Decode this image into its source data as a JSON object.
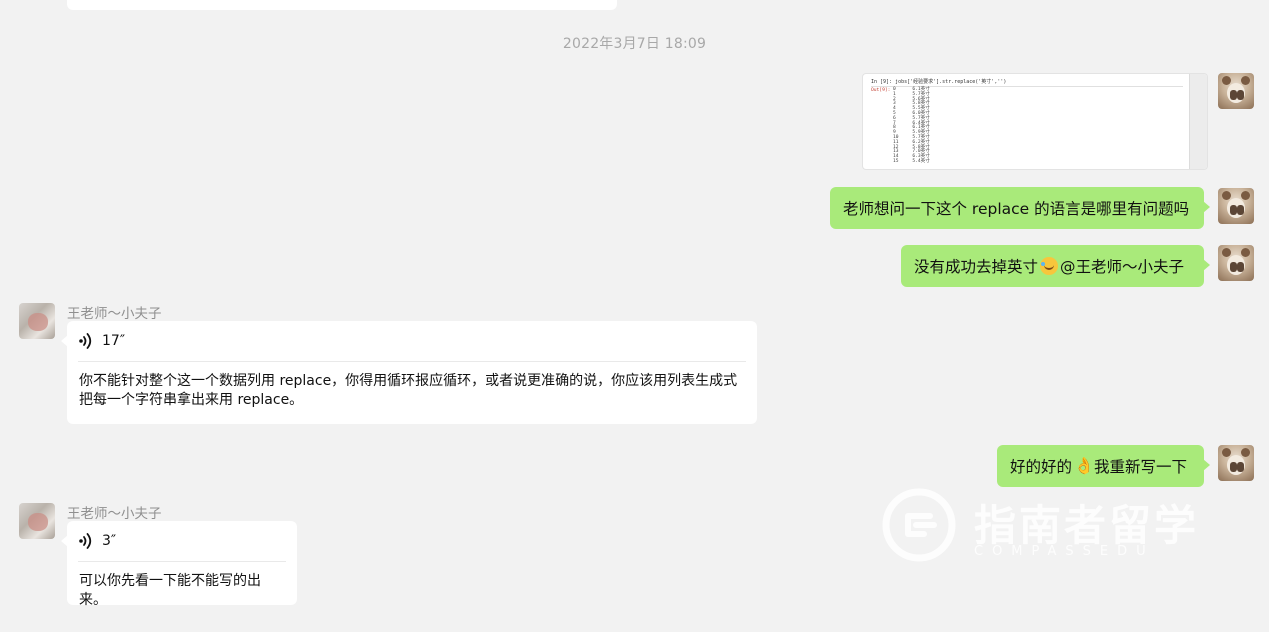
{
  "timestamp": "2022年3月7日 18:09",
  "code_snippet": {
    "line": "In [9]: jobs['经验要求'].str.replace('英寸','')",
    "out_label": "Out[9]:",
    "rows": "0      6.1英寸\n1      5.7英寸\n2      5.6英寸\n3      5.8英寸\n4      5.5英寸\n5      6.0英寸\n6      5.7英寸\n7      6.4英寸\n8      6.1英寸\n9      5.9英寸\n10     5.7英寸\n11     6.2英寸\n12     5.8英寸\n13     7.0英寸\n14     6.3英寸\n15     5.4英寸"
  },
  "messages": {
    "m1": "老师想问一下这个 replace 的语言是哪里有问题吗",
    "m2_before": "没有成功去掉英寸",
    "m2_after": "@王老师～小夫子",
    "voice1": {
      "sender": "王老师～小夫子",
      "duration": "17″",
      "transcript": "你不能针对整个这一个数据列用 replace，你得用循环报应循环，或者说更准确的说，你应该用列表生成式把每一个字符串拿出来用 replace。"
    },
    "m3_before": "好的好的",
    "m3_after": "我重新写一下",
    "voice2": {
      "sender": "王老师～小夫子",
      "duration": "3″",
      "transcript": "可以你先看一下能不能写的出来。"
    }
  },
  "watermark": {
    "title": "指南者留学",
    "subtitle": "COMPASSEDU"
  },
  "colors": {
    "background": "#f2f2f2",
    "bubble_self": "#a9ea7a",
    "bubble_other": "#ffffff",
    "meta_text": "#a8a8a8"
  }
}
